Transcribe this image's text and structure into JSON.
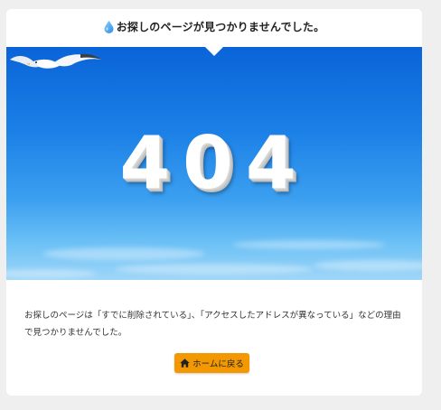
{
  "header": {
    "title": "お探しのページが見つかりませんでした。",
    "icon": "water-drop-icon"
  },
  "hero": {
    "code": "404",
    "decoration": "seagull"
  },
  "body": {
    "message": "お探しのページは「すでに削除されている」、「アクセスしたアドレスが異なっている」などの理由で見つかりませんでした。"
  },
  "home_button": {
    "label": "ホームに戻る",
    "icon": "home-icon",
    "color": "#f39800"
  },
  "colors": {
    "page_background": "#efefef",
    "card_background": "#ffffff",
    "sky_top": "#0a64d8",
    "sky_bottom": "#9fd6f8"
  }
}
